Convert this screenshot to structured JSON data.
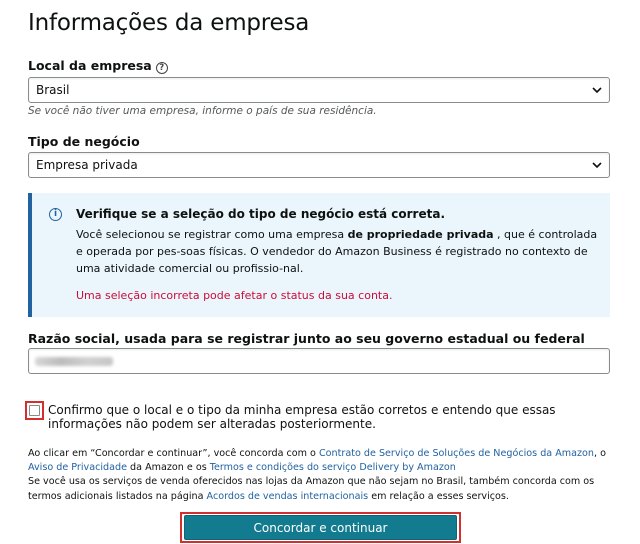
{
  "page": {
    "title": "Informações da empresa"
  },
  "location": {
    "label": "Local da empresa",
    "help_icon": "?",
    "value": "Brasil",
    "hint": "Se você não tiver uma empresa, informe o país de sua residência."
  },
  "business_type": {
    "label": "Tipo de negócio",
    "value": "Empresa privada"
  },
  "alert": {
    "icon": "i",
    "title": "Verifique se a seleção do tipo de negócio está correta.",
    "body_part1": "Você selecionou se registrar como uma empresa ",
    "body_bold": "de propriedade privada",
    "body_part2": " , que é controlada e operada por pes-soas físicas. O vendedor do Amazon Business é registrado no contexto de uma atividade comercial ou profissio-nal.",
    "warning": "Uma seleção incorreta pode afetar o status da sua conta."
  },
  "legal_name": {
    "label": "Razão social, usada para se registrar junto ao seu governo estadual ou federal"
  },
  "confirm": {
    "text": "Confirmo que o local e o tipo da minha empresa estão corretos e entendo que essas informações não podem ser alteradas posteriormente."
  },
  "legal": {
    "p1_a": "Ao clicar em “Concordar e continuar”, você concorda com o ",
    "link1": "Contrato de Serviço de Soluções de Negócios da Amazon",
    "p1_b": ", o ",
    "link2": "Aviso de Privacidade",
    "p1_c": " da Amazon e os ",
    "link3": "Termos e condições do serviço Delivery by Amazon",
    "p2_a": "Se você usa os serviços de venda oferecidos nas lojas da Amazon que não sejam no Brasil, também concorda com os termos adicionais listados na página ",
    "link4": "Acordos de vendas internacionais",
    "p2_b": " em relação a esses serviços."
  },
  "submit": {
    "label": "Concordar e continuar"
  },
  "colors": {
    "accent": "#137b8f",
    "link": "#2162a1",
    "alert_bg": "#eaf6fb",
    "warning": "#cc0c39",
    "highlight": "#d32f2f"
  }
}
